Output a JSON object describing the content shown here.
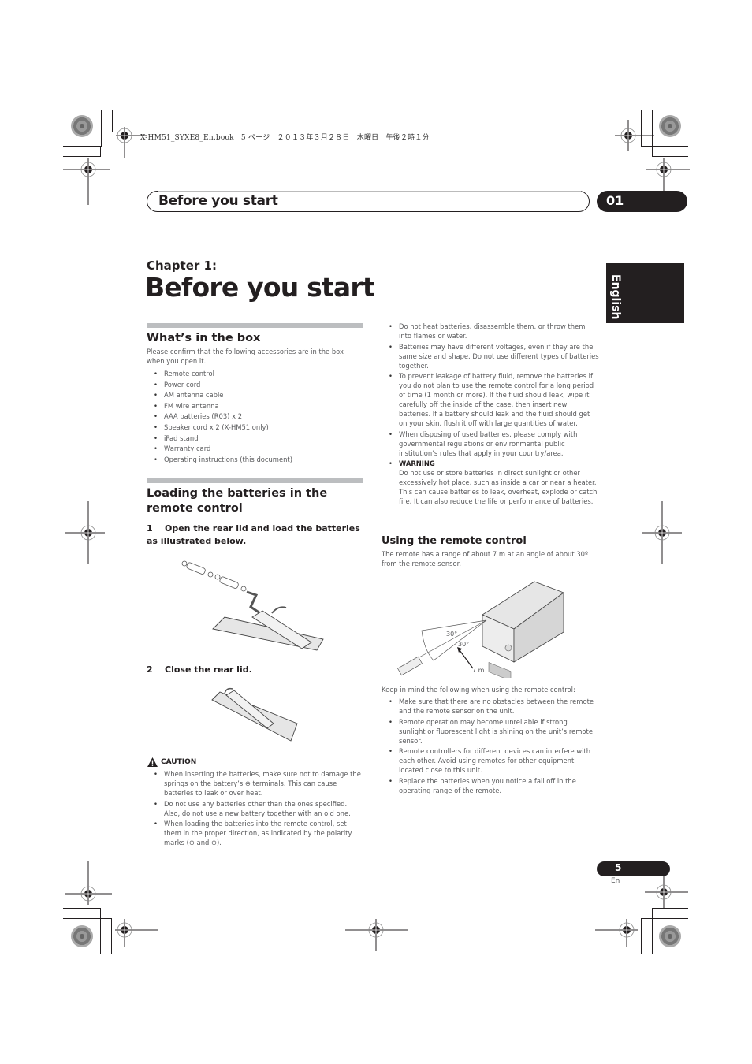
{
  "print_header": "X-HM51_SYXE8_En.book　5 ページ　２０１３年３月２８日　木曜日　午後２時１分",
  "running_header": {
    "title": "Before you start",
    "chapter_number": "01"
  },
  "language_tab": "English",
  "chapter": {
    "label": "Chapter 1:",
    "title": "Before you start"
  },
  "whats_in_box": {
    "heading": "What’s in the box",
    "intro": "Please confirm that the following accessories are in the box when you open it.",
    "items": [
      "Remote control",
      "Power cord",
      "AM antenna cable",
      "FM wire antenna",
      "AAA batteries (R03) x 2",
      "Speaker cord x 2 (X-HM51 only)",
      "iPad stand",
      "Warranty card",
      "Operating instructions (this document)"
    ]
  },
  "loading_batteries": {
    "heading": "Loading the batteries in the remote control",
    "steps": [
      {
        "num": "1",
        "text": "Open the rear lid and load the batteries as illustrated below."
      },
      {
        "num": "2",
        "text": "Close the rear lid."
      }
    ],
    "illustration_symbols": {
      "plus": "⊕",
      "minus": "⊖"
    }
  },
  "caution": {
    "title": "CAUTION",
    "items": [
      "When inserting the batteries, make sure not to damage the springs on the battery’s ⊖ terminals. This can cause batteries to leak or over heat.",
      "Do not use any batteries other than the ones specified. Also, do not use a new battery together with an old one.",
      "When loading the batteries into the remote control, set them in the proper direction, as indicated by the polarity marks (⊕ and ⊖)."
    ]
  },
  "right_column_bullets": [
    "Do not heat batteries, disassemble them, or throw them into flames or water.",
    "Batteries may have different voltages, even if they are the same size and shape. Do not use different types of batteries together.",
    "To prevent leakage of battery fluid, remove the batteries if you do not plan to use the remote control for a long period of time (1 month or more). If the fluid should leak, wipe it carefully off the inside of the case, then insert new batteries. If a battery should leak and the fluid should get on your skin, flush it off with large quantities of water.",
    "When disposing of used batteries, please comply with governmental regulations or environmental public institution’s rules that apply in your country/area."
  ],
  "warning": {
    "title": "WARNING",
    "text": "Do not use or store batteries in direct sunlight or other excessively hot place, such as inside a car or near a heater. This can cause batteries to leak, overheat, explode or catch fire. It can also reduce the life or performance of batteries."
  },
  "using_remote": {
    "heading": "Using the remote control",
    "intro": "The remote has a range of about 7 m at an angle of about 30º from the remote sensor.",
    "diagram_labels": {
      "angle_upper": "30°",
      "angle_lower": "30°",
      "range": "7 m"
    },
    "keep_in_mind": "Keep in mind the following when using the remote control:",
    "items": [
      "Make sure that there are no obstacles between the remote and the remote sensor on the unit.",
      "Remote operation may become unreliable if strong sunlight or fluorescent light is shining on the unit’s remote sensor.",
      "Remote controllers for different devices can interfere with each other. Avoid using remotes for other equipment located close to this unit.",
      "Replace the batteries when you notice a fall off in the operating range of the remote."
    ]
  },
  "footer": {
    "page_number": "5",
    "language_code": "En"
  }
}
